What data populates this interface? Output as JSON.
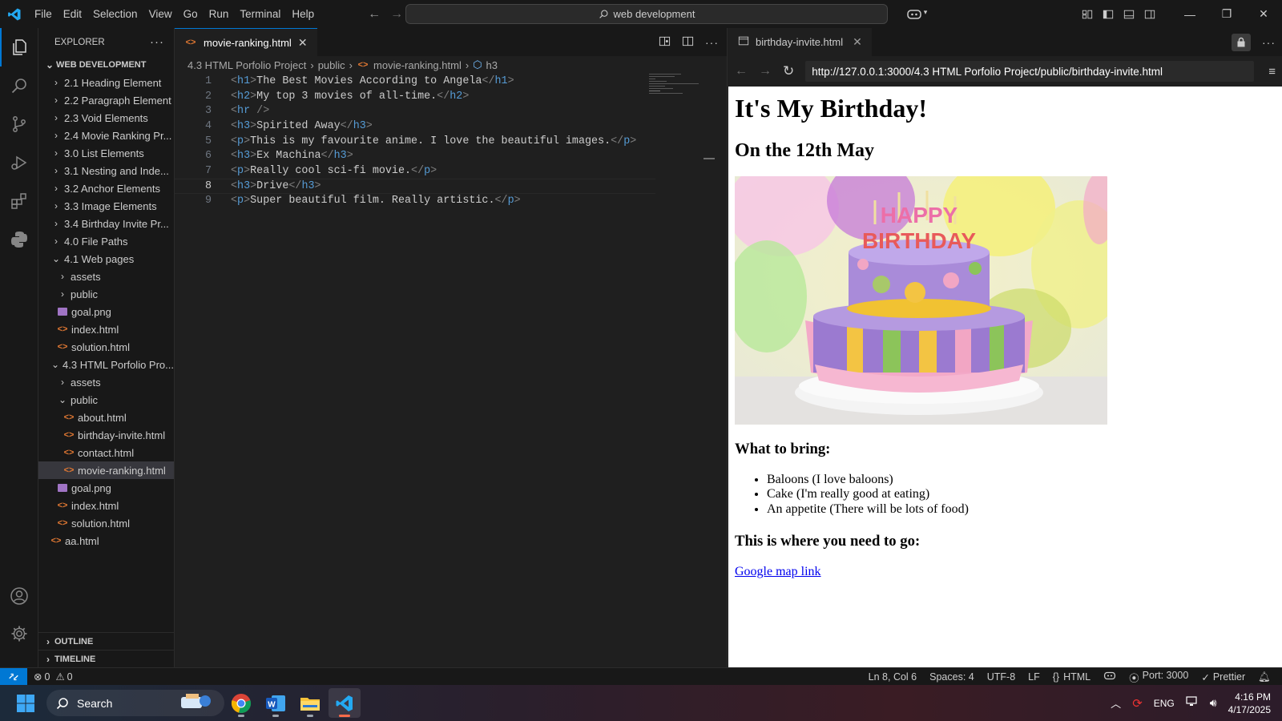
{
  "menu": [
    "File",
    "Edit",
    "Selection",
    "View",
    "Go",
    "Run",
    "Terminal",
    "Help"
  ],
  "command_center": "web development",
  "sidebar": {
    "title": "EXPLORER",
    "root": "WEB DEVELOPMENT",
    "items": [
      {
        "label": "2.1 Heading Element",
        "type": "folder",
        "depth": 1,
        "open": false
      },
      {
        "label": "2.2 Paragraph Element",
        "type": "folder",
        "depth": 1,
        "open": false
      },
      {
        "label": "2.3 Void Elements",
        "type": "folder",
        "depth": 1,
        "open": false
      },
      {
        "label": "2.4 Movie Ranking Pr...",
        "type": "folder",
        "depth": 1,
        "open": false
      },
      {
        "label": "3.0 List Elements",
        "type": "folder",
        "depth": 1,
        "open": false
      },
      {
        "label": "3.1 Nesting and Inde...",
        "type": "folder",
        "depth": 1,
        "open": false
      },
      {
        "label": "3.2 Anchor Elements",
        "type": "folder",
        "depth": 1,
        "open": false
      },
      {
        "label": "3.3 Image Elements",
        "type": "folder",
        "depth": 1,
        "open": false
      },
      {
        "label": "3.4 Birthday Invite Pr...",
        "type": "folder",
        "depth": 1,
        "open": false
      },
      {
        "label": "4.0 File Paths",
        "type": "folder",
        "depth": 1,
        "open": false
      },
      {
        "label": "4.1 Web pages",
        "type": "folder",
        "depth": 1,
        "open": true
      },
      {
        "label": "assets",
        "type": "folder",
        "depth": 2,
        "open": false
      },
      {
        "label": "public",
        "type": "folder",
        "depth": 2,
        "open": false
      },
      {
        "label": "goal.png",
        "type": "image",
        "depth": 2
      },
      {
        "label": "index.html",
        "type": "html",
        "depth": 2
      },
      {
        "label": "solution.html",
        "type": "html",
        "depth": 2
      },
      {
        "label": "4.3 HTML Porfolio Pro...",
        "type": "folder",
        "depth": 1,
        "open": true
      },
      {
        "label": "assets",
        "type": "folder",
        "depth": 2,
        "open": false
      },
      {
        "label": "public",
        "type": "folder",
        "depth": 2,
        "open": true
      },
      {
        "label": "about.html",
        "type": "html",
        "depth": 3
      },
      {
        "label": "birthday-invite.html",
        "type": "html",
        "depth": 3
      },
      {
        "label": "contact.html",
        "type": "html",
        "depth": 3
      },
      {
        "label": "movie-ranking.html",
        "type": "html",
        "depth": 3,
        "selected": true
      },
      {
        "label": "goal.png",
        "type": "image",
        "depth": 2
      },
      {
        "label": "index.html",
        "type": "html",
        "depth": 2
      },
      {
        "label": "solution.html",
        "type": "html",
        "depth": 2
      },
      {
        "label": "aa.html",
        "type": "html",
        "depth": 1
      }
    ],
    "outline": "OUTLINE",
    "timeline": "TIMELINE"
  },
  "editor": {
    "tab": "movie-ranking.html",
    "breadcrumb": [
      "4.3 HTML Porfolio Project",
      "public",
      "movie-ranking.html",
      "h3"
    ],
    "current_line": 8,
    "lines": [
      {
        "n": "1",
        "tag": "h1",
        "text": "The Best Movies According to Angela"
      },
      {
        "n": "2",
        "tag": "h2",
        "text": "My top 3 movies of all-time."
      },
      {
        "n": "3",
        "tag": "hr",
        "text": ""
      },
      {
        "n": "4",
        "tag": "h3",
        "text": "Spirited Away"
      },
      {
        "n": "5",
        "tag": "p",
        "text": "This is my favourite anime. I love the beautiful images."
      },
      {
        "n": "6",
        "tag": "h3",
        "text": "Ex Machina"
      },
      {
        "n": "7",
        "tag": "p",
        "text": "Really cool sci-fi movie."
      },
      {
        "n": "8",
        "tag": "h3",
        "text": "Drive"
      },
      {
        "n": "9",
        "tag": "p",
        "text": "Super beautiful film. Really artistic."
      }
    ]
  },
  "browser": {
    "tab": "birthday-invite.html",
    "url": "http://127.0.0.1:3000/4.3 HTML Porfolio Project/public/birthday-invite.html",
    "page": {
      "h1": "It's My Birthday!",
      "h2": "On the 12th May",
      "image_text": "HAPPY BIRTHDAY",
      "bring_heading": "What to bring:",
      "bring_items": [
        "Baloons (I love baloons)",
        "Cake (I'm really good at eating)",
        "An appetite (There will be lots of food)"
      ],
      "go_heading": "This is where you need to go:",
      "link": "Google map link"
    }
  },
  "statusbar": {
    "errors": "0",
    "warnings": "0",
    "position": "Ln 8, Col 6",
    "spaces": "Spaces: 4",
    "encoding": "UTF-8",
    "eol": "LF",
    "language": "HTML",
    "port": "Port: 3000",
    "formatter": "Prettier"
  },
  "taskbar": {
    "search": "Search",
    "lang": "ENG",
    "time": "4:16 PM",
    "date": "4/17/2025"
  }
}
